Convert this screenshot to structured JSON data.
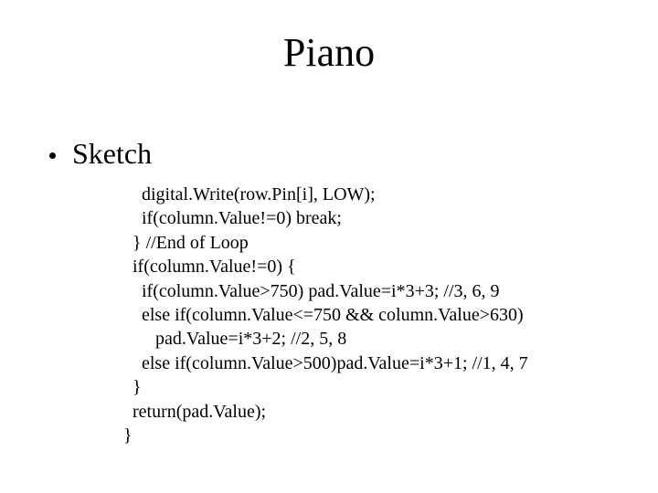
{
  "title": "Piano",
  "bullet": "Sketch",
  "code": "    digital.Write(row.Pin[i], LOW);\n    if(column.Value!=0) break;\n  } //End of Loop\n  if(column.Value!=0) {\n    if(column.Value>750) pad.Value=i*3+3; //3, 6, 9\n    else if(column.Value<=750 && column.Value>630)\n       pad.Value=i*3+2; //2, 5, 8\n    else if(column.Value>500)pad.Value=i*3+1; //1, 4, 7\n  }\n  return(pad.Value);\n}"
}
